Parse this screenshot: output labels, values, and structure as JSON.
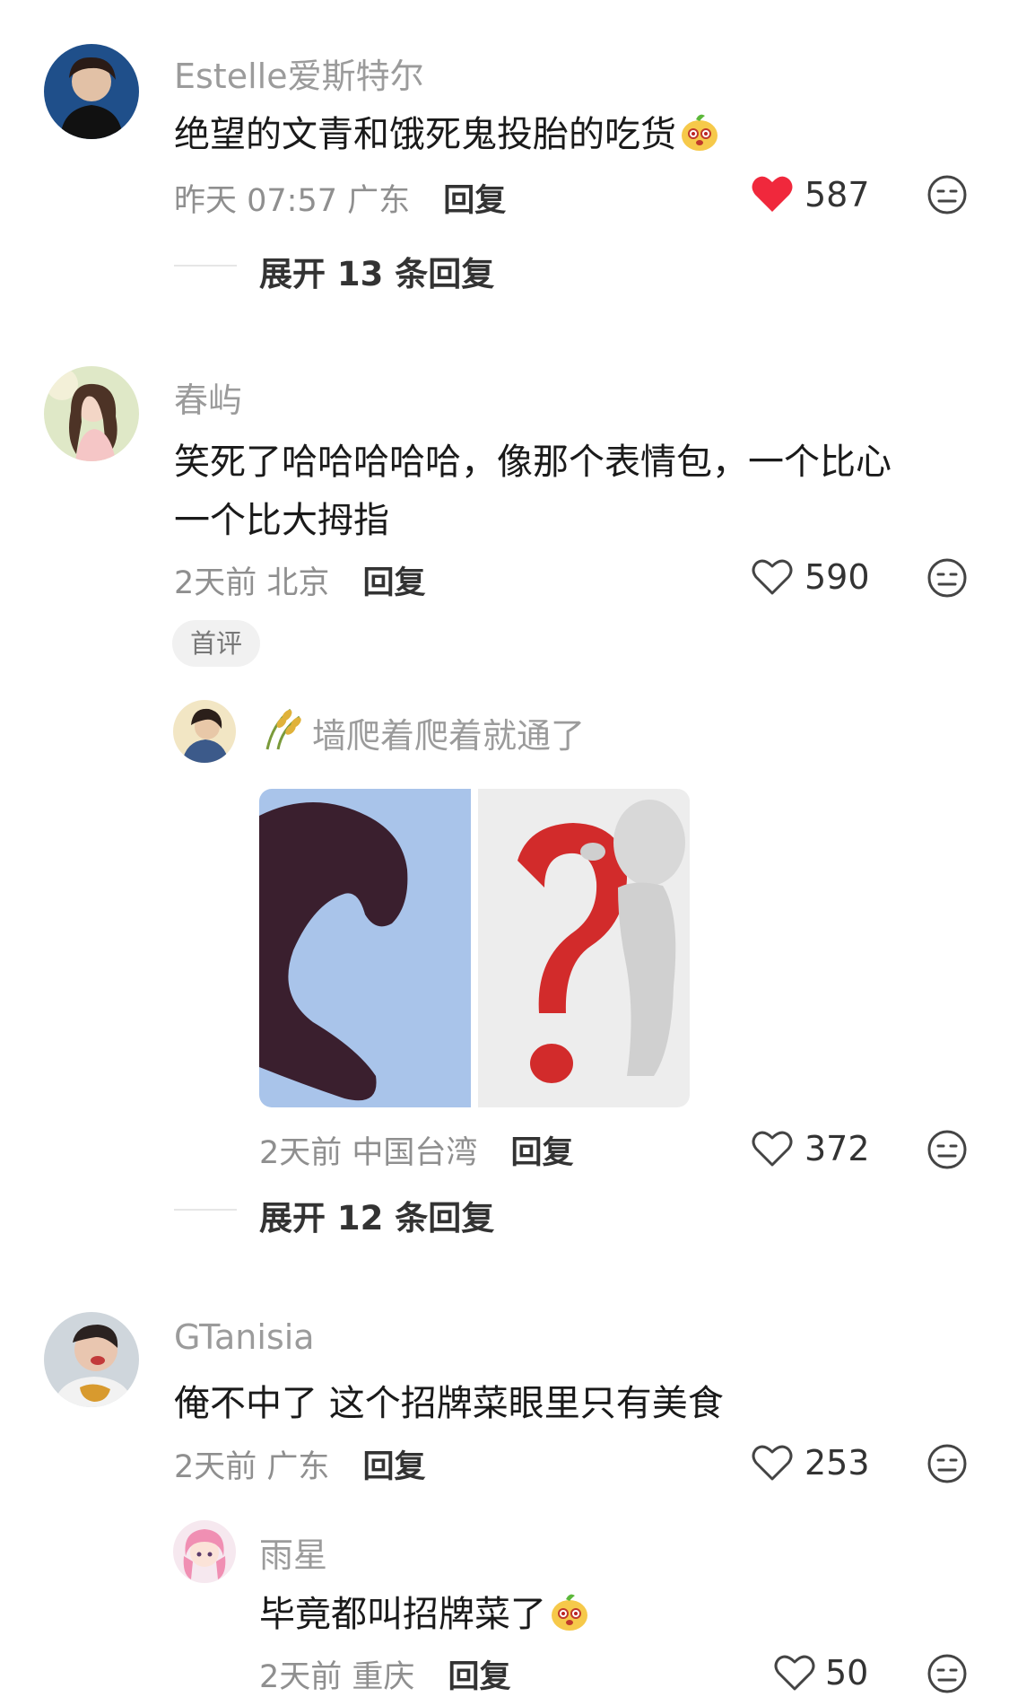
{
  "comments": [
    {
      "name": "Estelle爱斯特尔",
      "text": "绝望的文青和饿死鬼投胎的吃货",
      "time": "昨天 07:57 广东",
      "reply": "回复",
      "likes": "587",
      "liked": true,
      "expand": "展开 13 条回复"
    },
    {
      "name": "春屿",
      "text_line1": "笑死了哈哈哈哈哈，像那个表情包，一个比心",
      "text_line2": "一个比大拇指",
      "time": "2天前 北京",
      "reply": "回复",
      "likes": "590",
      "liked": false,
      "badge": "首评",
      "sub_reply": {
        "name": "墙爬着爬着就通了",
        "time": "2天前 中国台湾",
        "reply": "回复",
        "likes": "372"
      },
      "expand": "展开 12 条回复"
    },
    {
      "name": "GTanisia",
      "text": "俺不中了 这个招牌菜眼里只有美食",
      "time": "2天前 广东",
      "reply": "回复",
      "likes": "253",
      "liked": false,
      "sub_reply": {
        "name": "雨星",
        "text": "毕竟都叫招牌菜了",
        "time": "2天前 重庆",
        "reply": "回复",
        "likes": "50"
      }
    }
  ],
  "colors": {
    "liked_heart": "#f0283c",
    "name": "#9b9b9b",
    "text": "#1a1a1a",
    "meta": "#8f8f8f"
  },
  "icons": [
    "heart-filled-icon",
    "heart-outline-icon",
    "dislike-face-icon",
    "food-emoji-icon",
    "rice-plant-icon"
  ]
}
